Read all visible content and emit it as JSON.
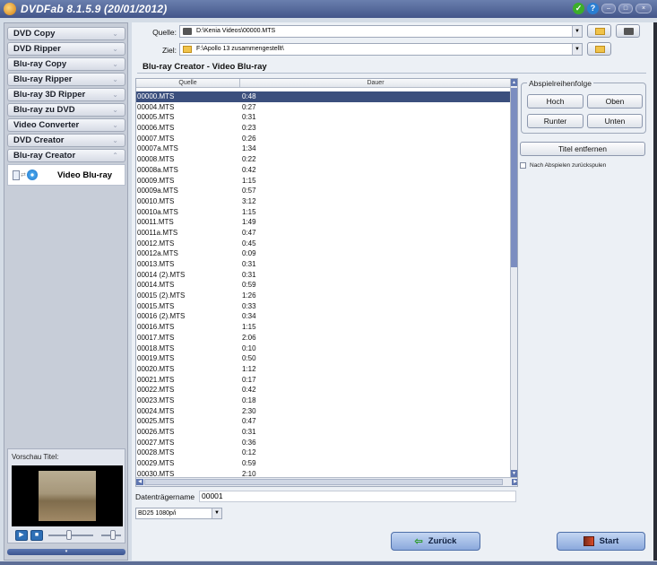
{
  "window": {
    "title": "DVDFab 8.1.5.9 (20/01/2012)",
    "ok_glyph": "✓",
    "help_glyph": "?",
    "min_glyph": "–",
    "max_glyph": "□",
    "close_glyph": "×"
  },
  "sidebar": {
    "items": [
      {
        "label": "DVD Copy",
        "expanded": false
      },
      {
        "label": "DVD Ripper",
        "expanded": false
      },
      {
        "label": "Blu-ray Copy",
        "expanded": false
      },
      {
        "label": "Blu-ray Ripper",
        "expanded": false
      },
      {
        "label": "Blu-ray 3D Ripper",
        "expanded": false
      },
      {
        "label": "Blu-ray zu DVD",
        "expanded": false
      },
      {
        "label": "Video Converter",
        "expanded": false
      },
      {
        "label": "DVD Creator",
        "expanded": false
      },
      {
        "label": "Blu-ray Creator",
        "expanded": true
      }
    ],
    "chevron_down": "⌄",
    "chevron_up": "⌃",
    "sub_item_label": "Video Blu-ray",
    "preview_label": "Vorschau Titel:",
    "play_glyph": "▶",
    "stop_glyph": "■",
    "collapse_glyph": "▾"
  },
  "paths": {
    "source_label": "Quelle:",
    "source_value": "D:\\Kenia Videos\\00000.MTS",
    "target_label": "Ziel:",
    "target_value": "F:\\Apollo 13 zusammengestellt\\"
  },
  "section_title": "Blu-ray Creator - Video Blu-ray",
  "table": {
    "columns": [
      "Quelle",
      "Dauer"
    ],
    "rows": [
      {
        "source": "00000.MTS",
        "duration": "0:48",
        "selected": true
      },
      {
        "source": "00004.MTS",
        "duration": "0:27"
      },
      {
        "source": "00005.MTS",
        "duration": "0:31"
      },
      {
        "source": "00006.MTS",
        "duration": "0:23"
      },
      {
        "source": "00007.MTS",
        "duration": "0:26"
      },
      {
        "source": "00007a.MTS",
        "duration": "1:34"
      },
      {
        "source": "00008.MTS",
        "duration": "0:22"
      },
      {
        "source": "00008a.MTS",
        "duration": "0:42"
      },
      {
        "source": "00009.MTS",
        "duration": "1:15"
      },
      {
        "source": "00009a.MTS",
        "duration": "0:57"
      },
      {
        "source": "00010.MTS",
        "duration": "3:12"
      },
      {
        "source": "00010a.MTS",
        "duration": "1:15"
      },
      {
        "source": "00011.MTS",
        "duration": "1:49"
      },
      {
        "source": "00011a.MTS",
        "duration": "0:47"
      },
      {
        "source": "00012.MTS",
        "duration": "0:45"
      },
      {
        "source": "00012a.MTS",
        "duration": "0:09"
      },
      {
        "source": "00013.MTS",
        "duration": "0:31"
      },
      {
        "source": "00014 (2).MTS",
        "duration": "0:31"
      },
      {
        "source": "00014.MTS",
        "duration": "0:59"
      },
      {
        "source": "00015 (2).MTS",
        "duration": "1:26"
      },
      {
        "source": "00015.MTS",
        "duration": "0:33"
      },
      {
        "source": "00016 (2).MTS",
        "duration": "0:34"
      },
      {
        "source": "00016.MTS",
        "duration": "1:15"
      },
      {
        "source": "00017.MTS",
        "duration": "2:06"
      },
      {
        "source": "00018.MTS",
        "duration": "0:10"
      },
      {
        "source": "00019.MTS",
        "duration": "0:50"
      },
      {
        "source": "00020.MTS",
        "duration": "1:12"
      },
      {
        "source": "00021.MTS",
        "duration": "0:17"
      },
      {
        "source": "00022.MTS",
        "duration": "0:42"
      },
      {
        "source": "00023.MTS",
        "duration": "0:18"
      },
      {
        "source": "00024.MTS",
        "duration": "2:30"
      },
      {
        "source": "00025.MTS",
        "duration": "0:47"
      },
      {
        "source": "00026.MTS",
        "duration": "0:31"
      },
      {
        "source": "00027.MTS",
        "duration": "0:36"
      },
      {
        "source": "00028.MTS",
        "duration": "0:12"
      },
      {
        "source": "00029.MTS",
        "duration": "0:59"
      },
      {
        "source": "00030.MTS",
        "duration": "2:10"
      }
    ],
    "scroll_up_glyph": "▲",
    "scroll_down_glyph": "▼",
    "scroll_left_glyph": "◀",
    "scroll_right_glyph": "▶"
  },
  "volume": {
    "label": "Datenträgername",
    "value": "00001"
  },
  "disc_type": {
    "selected": "BD25 1080p/i"
  },
  "order": {
    "legend": "Abspielreihenfolge",
    "hoch": "Hoch",
    "oben": "Oben",
    "runter": "Runter",
    "unten": "Unten"
  },
  "remove_title_label": "Titel entfernen",
  "rewind_checkbox_label": "Nach Abspielen zurückspulen",
  "actions": {
    "back_label": "Zurück",
    "back_glyph": "⇦",
    "start_label": "Start"
  },
  "colors": {
    "title_bar": "#44568a",
    "selection": "#3b4f7d",
    "accent_button": "#8aa8dc"
  }
}
